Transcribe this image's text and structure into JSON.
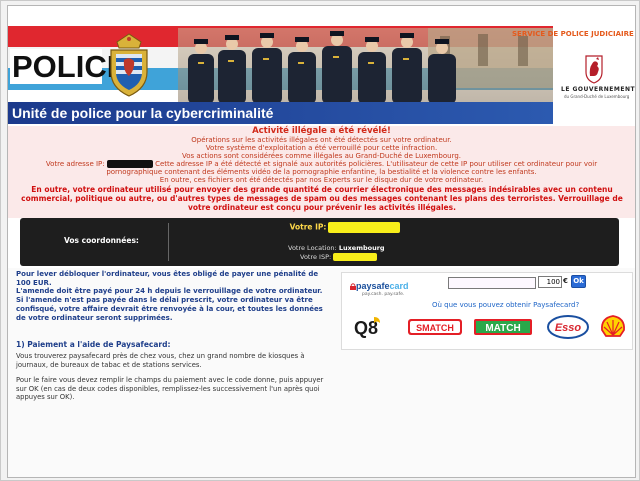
{
  "banner": {
    "police_label": "POLICE",
    "unit_title": "Unité de police pour la cybercriminalité",
    "service_title": "SERVICE DE POLICE JUDICIAIRE",
    "government_title": "LE GOUVERNEMENT",
    "government_sub": "du Grand-Duché de Luxembourg"
  },
  "warning": {
    "title": "Activité illégale a été révélé!",
    "line1": "Opérations sur les activités illégales ont été détectés sur votre ordinateur.",
    "line2": "Votre système d'exploitation a été verrouillé pour cette infraction.",
    "line3": "Vos actions sont considérées comme illégales au Grand-Duché de Luxembourg.",
    "line4a": "Votre adresse IP:",
    "line4b": "Cette adresse IP a été détecté et signalé aux autorités policières. L'utilisateur de cette IP pour utiliser cet ordinateur pour voir",
    "line5": "pornographique contenant des éléments vidéo de la pornographie enfantine, la bestialité et la violence contre les enfants.",
    "line6": "En outre, ces fichiers ont été détectés par nos Experts sur le disque dur de votre ordinateur.",
    "red_paragraph": "En outre, votre ordinateur utilisé pour envoyer des grande quantité de courrier électronique des messages indésirables avec un contenu commercial, politique ou autre, ou d'autres types de messages de spam ou des messages contenant les plans des terroristes. Verrouillage de votre ordinateur est conçu pour prévenir les activités illégales."
  },
  "coordinates": {
    "label": "Vos coordonnées:",
    "ip_label": "Votre IP:",
    "location_label": "Votre Location:",
    "location_value": "Luxembourg",
    "isp_label": "Votre ISP:"
  },
  "instructions": {
    "para1": "Pour lever débloquer l'ordinateur, vous êtes obligé de payer une pénalité de 100 EUR.",
    "para2": "L'amende doit être payé pour 24 h depuis le verrouillage de votre ordinateur.",
    "para3": "Si l'amende n'est pas payée dans le délai prescrit, votre ordinateur va être confisqué, votre affaire devrait être renvoyée à la cour, et toutes les données de votre ordinateur seront supprimées.",
    "payment_heading": "1) Paiement a l'aide de Paysafecard:",
    "payment_p1": "Vous trouverez paysafecard près de chez vous, chez un grand nombre de kiosques à journaux, de bureaux de tabac et de stations services.",
    "payment_p2": "Pour le faire vous devez remplir le champs du paiement avec le code donne, puis appuyer sur OK (en cas de deux codes disponibles, remplissez-les successivement l'un après quoi appuyes sur OK)."
  },
  "paysafecard": {
    "logo_text_a": "paysafe",
    "logo_text_b": "card",
    "tagline": "pay.cash. pay.safe.",
    "code_value": "",
    "amount": "100",
    "currency": "€",
    "ok_label": "Ok",
    "where_link": "Où que vous pouvez obtenir Paysafecard?",
    "brands": [
      "Q8",
      "SMATCH",
      "MATCH",
      "Esso",
      "Shell"
    ]
  },
  "colors": {
    "flag_red": "#e0272f",
    "flag_blue": "#3fa3d9",
    "unit_bar": "#1c3a8c",
    "warning_text": "#c0391e",
    "highlight_yellow": "#f8ee1a"
  }
}
